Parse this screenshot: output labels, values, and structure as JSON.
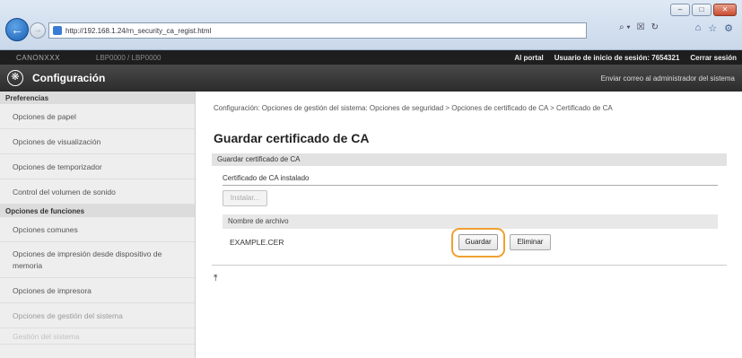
{
  "browser": {
    "url": "http://192.168.1.24/rn_security_ca_regist.html",
    "address_tools": [
      "⌕ ▾",
      "☒",
      "↻"
    ],
    "right_icons": [
      "⌂",
      "☆",
      "⚙"
    ],
    "window_controls": [
      "–",
      "□",
      "✕"
    ]
  },
  "topbar": {
    "device": "CANONXXX",
    "blurred": "LBP0000 / LBP0000",
    "portal": "Al portal",
    "user_label": "Usuario de inicio de sesión:",
    "user_id": "7654321",
    "logout": "Cerrar sesión"
  },
  "header": {
    "title": "Configuración",
    "mail": "Enviar correo al administrador del sistema"
  },
  "sidebar": {
    "section1": "Preferencias",
    "items1": [
      "Opciones de papel",
      "Opciones de visualización",
      "Opciones de temporizador",
      "Control del volumen de sonido"
    ],
    "section2": "Opciones de funciones",
    "items2": [
      "Opciones comunes",
      "Opciones de impresión desde dispositivo de memoria",
      "Opciones de impresora"
    ],
    "item_faded": "Opciones de gestión del sistema",
    "item_fainter": "Gestión del sistema"
  },
  "main": {
    "breadcrumb": "Configuración: Opciones de gestión del sistema: Opciones de seguridad > Opciones de certificado de CA > Certificado de CA",
    "title": "Guardar certificado de CA",
    "section": "Guardar certificado de CA",
    "subsection": "Certificado de CA instalado",
    "install_button": "Instalar...",
    "file_header": "Nombre de archivo",
    "file_name": "EXAMPLE.CER",
    "save_button": "Guardar",
    "delete_button": "Eliminar",
    "top_icon": "⤒"
  },
  "colors": {
    "highlight": "#f0a030",
    "header_bg": "#2c2c2c",
    "sidebar_bg": "#eeeeee"
  }
}
